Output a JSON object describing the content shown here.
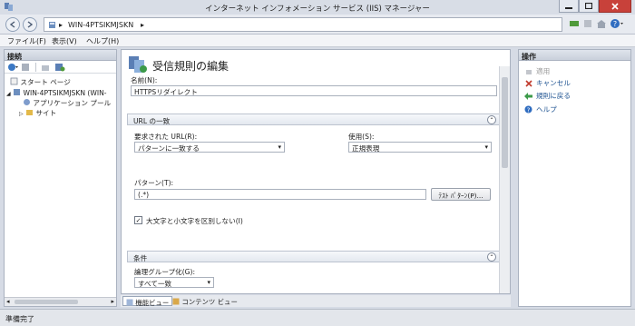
{
  "window": {
    "title": "インターネット インフォメーション サービス (IIS) マネージャー"
  },
  "address": {
    "segments": [
      "WIN-4PTSIKMJSKN"
    ]
  },
  "menu": {
    "items": [
      "ファイル(F)",
      "表示(V)",
      "ヘルプ(H)"
    ]
  },
  "connections": {
    "title": "接続",
    "tree": [
      {
        "label": "スタート ページ",
        "icon": "start-page-icon"
      },
      {
        "label": "WIN-4PTSIKMJSKN (WIN-",
        "icon": "server-icon"
      },
      {
        "label": "アプリケーション プール",
        "icon": "app-pool-icon"
      },
      {
        "label": "サイト",
        "icon": "sites-icon"
      }
    ]
  },
  "editor": {
    "page_title": "受信規則の編集",
    "name_label": "名前(N):",
    "name_value": "HTTPSリダイレクト",
    "url_section_title": "URL の一致",
    "requested_url_label": "要求された URL(R):",
    "requested_url_value": "パターンに一致する",
    "using_label": "使用(S):",
    "using_value": "正規表現",
    "pattern_label": "パターン(T):",
    "pattern_value": "(.*)",
    "test_pattern_button": "ﾃｽﾄ ﾊﾟﾀｰﾝ(P)...",
    "ignore_case_label": "大文字と小文字を区別しない(I)",
    "ignore_case_checked": true,
    "conditions_section_title": "条件",
    "logical_grouping_label": "論理グループ化(G):",
    "logical_grouping_value": "すべて一致"
  },
  "view_tabs": {
    "features": "機能ビュー",
    "content": "コンテンツ ビュー"
  },
  "actions": {
    "title": "操作",
    "apply": "適用",
    "cancel": "キャンセル",
    "back_to_rules": "規則に戻る",
    "help": "ヘルプ"
  },
  "status": {
    "text": "準備完了"
  },
  "colors": {
    "accent": "#1a4f8f",
    "close_button": "#c8413a"
  }
}
